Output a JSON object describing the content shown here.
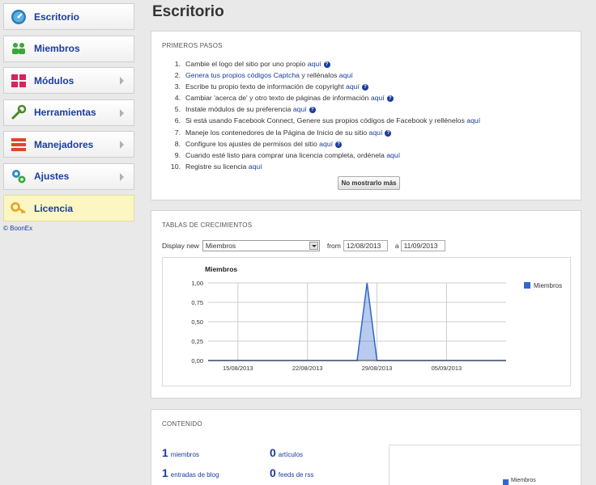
{
  "sidebar": {
    "items": [
      {
        "label": "Escritorio",
        "icon": "dashboard-icon"
      },
      {
        "label": "Miembros",
        "icon": "members-icon"
      },
      {
        "label": "Módulos",
        "icon": "modules-icon"
      },
      {
        "label": "Herramientas",
        "icon": "tools-icon"
      },
      {
        "label": "Manejadores",
        "icon": "handlers-icon"
      },
      {
        "label": "Ajustes",
        "icon": "settings-icon"
      },
      {
        "label": "Licencia",
        "icon": "key-icon"
      }
    ],
    "copyright": "© BoonEx"
  },
  "page_title": "Escritorio",
  "first_steps": {
    "title": "PRIMEROS PASOS",
    "steps": [
      {
        "num": "1.",
        "before": "Cambie el logo del sitio por uno propio ",
        "link": "aquí",
        "after": "",
        "help": true
      },
      {
        "num": "2.",
        "before": "",
        "link": "Genera tus propios códigos Captcha",
        "after": " y rellénalos ",
        "link2": "aquí",
        "help": false
      },
      {
        "num": "3.",
        "before": "Escribe tu propio texto de información de copyright ",
        "link": "aquí",
        "after": "",
        "help": true
      },
      {
        "num": "4.",
        "before": "Cambiar 'acerca de' y otro texto de páginas de información ",
        "link": "aquí",
        "after": "",
        "help": true
      },
      {
        "num": "5.",
        "before": "Instale módulos de su preferencia ",
        "link": "aquí",
        "after": "",
        "help": true
      },
      {
        "num": "6.",
        "before": "Si está usando Facebook Connect, Genere sus propios códigos de Facebook y rellénelos ",
        "link": "aquí",
        "after": "",
        "help": false
      },
      {
        "num": "7.",
        "before": "Maneje los contenedores de la Página de Inicio de su sitio ",
        "link": "aquí",
        "after": "",
        "help": true
      },
      {
        "num": "8.",
        "before": "Configure los ajustes de permisos del sitio ",
        "link": "aquí",
        "after": "",
        "help": true
      },
      {
        "num": "9.",
        "before": "Cuando esté listo para comprar una licencia completa, ordénela ",
        "link": "aquí",
        "after": "",
        "help": false
      },
      {
        "num": "10.",
        "before": "Registre su licencia ",
        "link": "aquí",
        "after": "",
        "help": false
      }
    ],
    "help_glyph": "?",
    "dismiss_button": "No mostrarlo más"
  },
  "growth": {
    "title": "TABLAS DE CRECIMIENTOS",
    "display_label": "Display new",
    "display_value": "Miembros",
    "from_label": "from",
    "from_value": "12/08/2013",
    "to_label": "a",
    "to_value": "11/09/2013"
  },
  "chart_data": {
    "type": "area",
    "title": "Miembros",
    "series": [
      {
        "name": "Miembros",
        "color": "#3366cc",
        "x": [
          "12/08/2013",
          "13/08/2013",
          "14/08/2013",
          "15/08/2013",
          "16/08/2013",
          "17/08/2013",
          "18/08/2013",
          "19/08/2013",
          "20/08/2013",
          "21/08/2013",
          "22/08/2013",
          "23/08/2013",
          "24/08/2013",
          "25/08/2013",
          "26/08/2013",
          "27/08/2013",
          "28/08/2013",
          "29/08/2013",
          "30/08/2013",
          "31/08/2013",
          "01/09/2013",
          "02/09/2013",
          "03/09/2013",
          "04/09/2013",
          "05/09/2013",
          "06/09/2013",
          "07/09/2013",
          "08/09/2013",
          "09/09/2013",
          "10/09/2013",
          "11/09/2013"
        ],
        "values": [
          0,
          0,
          0,
          0,
          0,
          0,
          0,
          0,
          0,
          0,
          0,
          0,
          0,
          0,
          0,
          0,
          1,
          0,
          0,
          0,
          0,
          0,
          0,
          0,
          0,
          0,
          0,
          0,
          0,
          0,
          0
        ]
      }
    ],
    "yticks": [
      "0,00",
      "0,25",
      "0,50",
      "0,75",
      "1,00"
    ],
    "xticks": [
      "15/08/2013",
      "22/08/2013",
      "29/08/2013",
      "05/09/2013"
    ],
    "ylim": [
      0,
      1
    ],
    "legend": "right",
    "grid": true
  },
  "content": {
    "title": "CONTENIDO",
    "stats": [
      {
        "n": "1",
        "label": "miembros"
      },
      {
        "n": "0",
        "label": "artículos"
      },
      {
        "n": "1",
        "label": "entradas de blog"
      },
      {
        "n": "0",
        "label": "feeds de rss"
      }
    ],
    "mini_legend": "Miembros"
  }
}
